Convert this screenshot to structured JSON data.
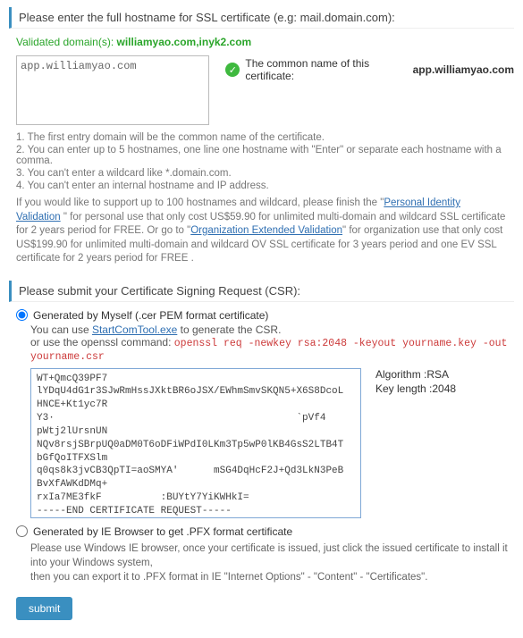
{
  "section_hostname": {
    "header": "Please enter the full hostname for SSL certificate (e.g: mail.domain.com):",
    "validated_label": "Validated domain(s): ",
    "validated_domains": "williamyao.com,inyk2.com",
    "hostname_value": "app.williamyao.com",
    "common_name_prefix": "The common name of this certificate: ",
    "common_name": "app.williamyao.com",
    "notes": {
      "n1": "1. The first entry domain will be the common name of the certificate.",
      "n2": "2. You can enter up to 5 hostnames, one line one hostname with \"Enter\" or separate each hostname with a comma.",
      "n3": "3. You can't enter a wildcard like *.domain.com.",
      "n4": "4. You can't enter an internal hostname and IP address."
    },
    "upsell_pre": "If you would like to support up to 100 hostnames and wildcard, please finish the \"",
    "upsell_link1": "Personal Identity Validation",
    "upsell_mid1": " \" for personal use that only cost US$59.90 for unlimited multi-domain and wildcard SSL certificate for 2 years period for FREE. Or go to \"",
    "upsell_link2": "Organization Extended Validation",
    "upsell_mid2": "\" for organization use that only cost US$199.90 for unlimited multi-domain and wildcard OV SSL certificate for 3 years period and one EV SSL certificate for 2 years period for FREE ."
  },
  "section_csr": {
    "header": "Please submit your Certificate Signing Request (CSR):",
    "opt_self_label": "Generated by Myself   (.cer PEM format certificate)",
    "startcom_pre": "You can use ",
    "startcom_link": "StartComTool.exe",
    "startcom_post": " to generate the CSR.",
    "openssl_pre": "or use the openssl command: ",
    "openssl_cmd": "openssl req -newkey rsa:2048 -keyout yourname.key -out yourname.csr",
    "csr_text": "WT+QmcQ39PF7\nlYDqU4dG1r3SJwRmHssJXktBR6oJSX/EWhmSmvSKQN5+X6S8DcoL\nHNCE+Kt1yc7R\nY3·                                         `pVf4\npWtj2lUrsnUN\nNQv8rsjSBrpUQ0aDM0T6oDFiWPdI0LKm3Tp5wP0lKB4GsS2LTB4T\nbGfQoITFXSlm\nq0qs8k3jvCB3QpTI=aoSMYA'      mSG4DqHcF2J+Qd3LkN3PeB\nBvXfAWKdDMq+\nrxIa7ME3fkF          :BUYtY7YiKWHkI=\n-----END CERTIFICATE REQUEST-----\n",
    "algo_label": "Algorithm :",
    "algo_value": "RSA",
    "keylen_label": "Key length :",
    "keylen_value": "2048",
    "opt_ie_label": "Generated by IE Browser to get .PFX format certificate",
    "ie_line1": "Please use Windows IE browser, once your certificate is issued, just click the issued certificate to install it into your Windows system,",
    "ie_line2": "then you can export it to .PFX format in IE \"Internet Options\" - \"Content\" - \"Certificates\".",
    "submit_label": "submit"
  }
}
